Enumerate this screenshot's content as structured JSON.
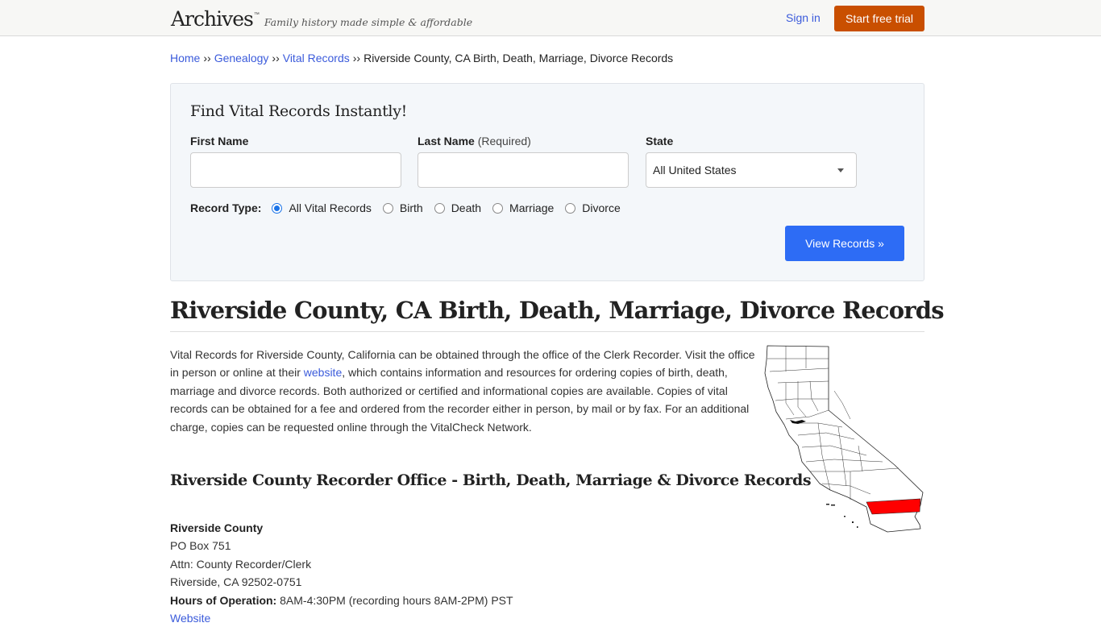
{
  "header": {
    "logo": "Archives",
    "logo_tm": "™",
    "tagline": "Family history made simple & affordable",
    "signin_label": "Sign in",
    "trial_label": "Start free trial"
  },
  "breadcrumb": {
    "items": [
      {
        "label": "Home",
        "link": true
      },
      {
        "label": "Genealogy",
        "link": true
      },
      {
        "label": "Vital Records",
        "link": true
      },
      {
        "label": "Riverside County, CA Birth, Death, Marriage, Divorce Records",
        "link": false
      }
    ],
    "separator": "››"
  },
  "search": {
    "title": "Find Vital Records Instantly!",
    "first_name_label": "First Name",
    "first_name_value": "",
    "last_name_label": "Last Name",
    "last_name_required": "(Required)",
    "last_name_value": "",
    "state_label": "State",
    "state_value": "All United States",
    "record_type_label": "Record Type:",
    "record_types": [
      {
        "label": "All Vital Records",
        "checked": true
      },
      {
        "label": "Birth",
        "checked": false
      },
      {
        "label": "Death",
        "checked": false
      },
      {
        "label": "Marriage",
        "checked": false
      },
      {
        "label": "Divorce",
        "checked": false
      }
    ],
    "submit_label": "View Records »"
  },
  "main": {
    "title": "Riverside County, CA Birth, Death, Marriage, Divorce Records",
    "intro_before_link": "Vital Records for Riverside County, California can be obtained through the office of the Clerk Recorder. Visit the office in person or online at their ",
    "intro_link": "website",
    "intro_after_link": ", which contains information and resources for ordering copies of birth, death, marriage and divorce records. Both authorized or certified and informational copies are available. Copies of vital records can be obtained for a fee and ordered from the recorder either in person, by mail or by fax. For an additional charge, copies can be requested online through the VitalCheck Network.",
    "map_alt": "California county map with Riverside County highlighted",
    "section_title": "Riverside County Recorder Office - Birth, Death, Marriage & Divorce Records",
    "office": {
      "name": "Riverside County",
      "line1": "PO Box 751",
      "line2": "Attn: County Recorder/Clerk",
      "line3": "Riverside, CA 92502-0751",
      "hours_label": "Hours of Operation:",
      "hours_value": " 8AM-4:30PM (recording hours 8AM-2PM) PST",
      "website_label": "Website"
    }
  },
  "colors": {
    "link": "#3b5bdb",
    "trial_button": "#c94f00",
    "view_button": "#2d6cf5",
    "highlight_county": "#ff0000"
  }
}
